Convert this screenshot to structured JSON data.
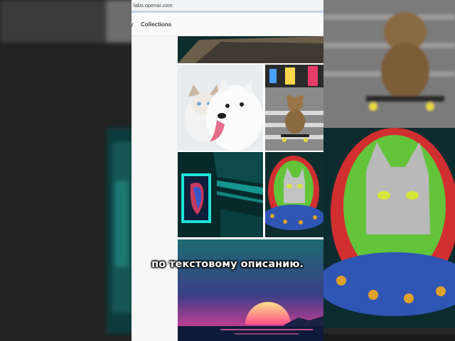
{
  "browser": {
    "url": "labs.openai.com"
  },
  "nav": {
    "partial_tab": "y",
    "collections_label": "Collections"
  },
  "gallery": {
    "images": [
      {
        "subject": "cat and samoyed dog"
      },
      {
        "subject": "teddy bear skateboarding in Times Square"
      },
      {
        "subject": "neon portrait poster in subway"
      },
      {
        "subject": "crayon cat in flying saucer"
      },
      {
        "subject": "synthwave sunset over sea"
      }
    ]
  },
  "subtitle": {
    "text": "по текстовому описанию."
  },
  "colors": {
    "url_underline": "#c8d3ea",
    "sunset_pink": "#ff3c9a",
    "neon_cyan": "#1fe0d6"
  }
}
